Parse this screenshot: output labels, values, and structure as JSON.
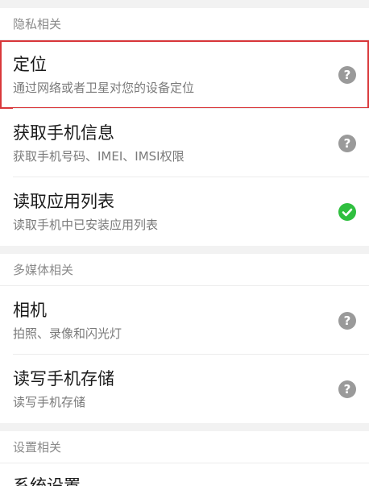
{
  "sections": [
    {
      "header": "隐私相关",
      "items": [
        {
          "title": "定位",
          "desc": "通过网络或者卫星对您的设备定位",
          "status": "question-icon"
        },
        {
          "title": "获取手机信息",
          "desc": "获取手机号码、IMEI、IMSI权限",
          "status": "question-icon"
        },
        {
          "title": "读取应用列表",
          "desc": "读取手机中已安装应用列表",
          "status": "check-icon"
        }
      ]
    },
    {
      "header": "多媒体相关",
      "items": [
        {
          "title": "相机",
          "desc": "拍照、录像和闪光灯",
          "status": "question-icon"
        },
        {
          "title": "读写手机存储",
          "desc": "读写手机存储",
          "status": "question-icon"
        }
      ]
    },
    {
      "header": "设置相关",
      "items": [
        {
          "title": "系统设置"
        }
      ]
    }
  ],
  "colors": {
    "question": "#9a9a9a",
    "check": "#2fbf3f",
    "highlight": "#d9373a"
  }
}
